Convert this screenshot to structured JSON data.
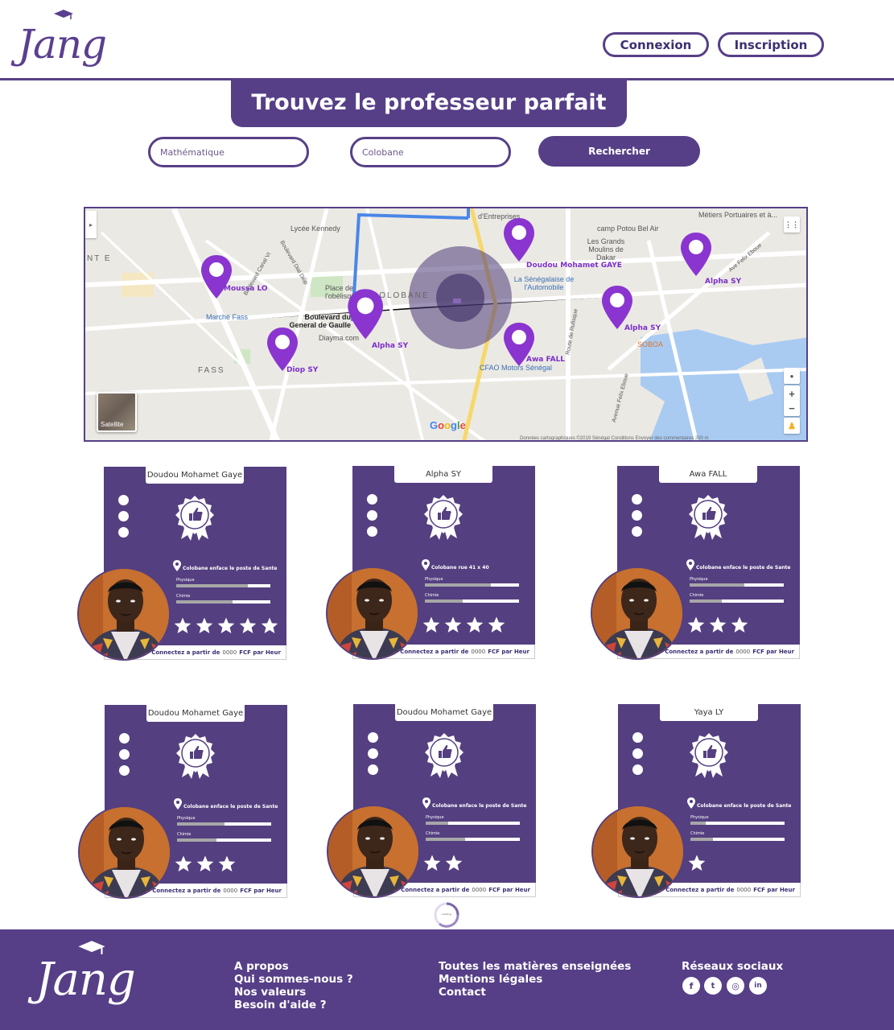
{
  "header": {
    "logo_text": "Jang",
    "login_label": "Connexion",
    "signup_label": "Inscription"
  },
  "hero": {
    "title": "Trouvez le professeur parfait"
  },
  "search": {
    "subject_placeholder": "Mathématique",
    "location_placeholder": "Colobane",
    "button_label": "Rechercher"
  },
  "map": {
    "places": {
      "lycee": "Lycée Kennedy",
      "place_obelisque": "Place de l'obélisque",
      "colobane": "COLOBANE",
      "boulevard": "Boulevard du General de Gaulle",
      "diayma": "Diayma.com",
      "marche": "Marché Fass",
      "fass": "FASS",
      "nte": "NT E",
      "entreprises": "d'Entreprises",
      "camp": "camp Potou Bel Air",
      "moulins": "Les Grands Moulins de Dakar",
      "senegalaise": "La Sénégalaise de l'Automobile",
      "cfao": "CFAO Motors Sénégal",
      "soboa": "SOBOA",
      "metiers": "Métiers Portuaires et à...",
      "canal": "Boulevard Canal VI",
      "route_rufisque": "Route de Rufisque",
      "avenue_felix": "Avenue Felix Eboue",
      "ave_felix2": "Ave Felix Eboue",
      "bd_dial_diop": "Boulevard Dial Diop"
    },
    "satellite_label": "Satellite",
    "google_label": "Google",
    "footer_text": "Données cartographiques ©2019   Sénégal   Conditions   Envoyer des commentaires   200 m",
    "zoom_in": "+",
    "zoom_out": "−",
    "pins": [
      {
        "name": "Moussa LO"
      },
      {
        "name": "Doudou Mohamet GAYE"
      },
      {
        "name": "Alpha SY"
      },
      {
        "name": "Alpha SY"
      },
      {
        "name": "Alpha SY"
      },
      {
        "name": "Diop SY"
      },
      {
        "name": "Awa FALL"
      }
    ]
  },
  "cards": [
    {
      "name": "Doudou Mohamet Gaye",
      "address": "Colobane enface le poste de Sante",
      "subjects": [
        {
          "label": "Physique",
          "level": 0.76
        },
        {
          "label": "Chimie",
          "level": 0.6
        }
      ],
      "rating": 5,
      "footer_prefix": "Connectez a partir de",
      "price": "0000",
      "footer_suffix": "FCF  par Heur"
    },
    {
      "name": "Alpha SY",
      "address": "Colobane rue 41 x 40",
      "subjects": [
        {
          "label": "Physique",
          "level": 0.7
        },
        {
          "label": "Chimie",
          "level": 0.4
        }
      ],
      "rating": 4,
      "footer_prefix": "Connectez a partir de",
      "price": "0000",
      "footer_suffix": "FCF  par Heur"
    },
    {
      "name": "Awa FALL",
      "address": "Colobane enface le poste de Sante",
      "subjects": [
        {
          "label": "Physique",
          "level": 0.58
        },
        {
          "label": "Chimie",
          "level": 0.34
        }
      ],
      "rating": 3,
      "footer_prefix": "Connectez a partir de",
      "price": "0000",
      "footer_suffix": "FCF  par Heur"
    },
    {
      "name": "Doudou Mohamet Gaye",
      "address": "Colobane enface le poste de Sante",
      "subjects": [
        {
          "label": "Physique",
          "level": 0.5
        },
        {
          "label": "Chimie",
          "level": 0.42
        }
      ],
      "rating": 3,
      "footer_prefix": "Connectez a partir de",
      "price": "0000",
      "footer_suffix": "FCF  par Heur"
    },
    {
      "name": "Doudou Mohamet Gaye",
      "address": "Colobane enface le poste de Sante",
      "subjects": [
        {
          "label": "Physique",
          "level": 0.24
        },
        {
          "label": "Chimie",
          "level": 0.42
        }
      ],
      "rating": 2,
      "footer_prefix": "Connectez a partir de",
      "price": "0000",
      "footer_suffix": "FCF  par Heur"
    },
    {
      "name": "Yaya LY",
      "address": "Colobane enface le poste de Sante",
      "subjects": [
        {
          "label": "Physique",
          "level": 0.16
        },
        {
          "label": "Chimie",
          "level": 0.24
        }
      ],
      "rating": 1,
      "footer_prefix": "Connectez a partir de",
      "price": "0000",
      "footer_suffix": "FCF  par Heur"
    }
  ],
  "loader_text": "Loading",
  "footer": {
    "logo_text": "Jang",
    "col1": [
      "A propos",
      "Qui sommes-nous ?",
      "Nos valeurs",
      "Besoin d'aide ?"
    ],
    "col2": [
      "Toutes les matières enseignées",
      "Mentions légales",
      "Contact"
    ],
    "social_title": "Réseaux sociaux",
    "social_icons": [
      "facebook-icon",
      "twitter-icon",
      "instagram-icon",
      "linkedin-icon"
    ],
    "social_glyphs": [
      "f",
      "t",
      "◎",
      "in"
    ]
  },
  "colors": {
    "brand": "#563f87",
    "pin": "#8a35cf",
    "card": "#543f80"
  }
}
